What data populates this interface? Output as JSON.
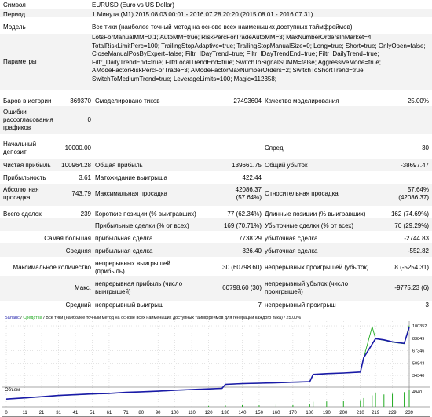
{
  "report": {
    "symbol_label": "Символ",
    "symbol_value": "EURUSD (Euro vs US Dollar)",
    "period_label": "Период",
    "period_value": "1 Минута (M1) 2015.08.03 00:01 - 2016.07.28 20:20 (2015.08.01 - 2016.07.31)",
    "model_label": "Модель",
    "model_value": "Все тики (наиболее точный метод на основе всех наименьших доступных таймфреймов)",
    "params_label": "Параметры",
    "params_value": "LotsForManualMM=0.1; AutoMM=true; RiskPercForTradeAutoMM=3; MaxNumberOrdersInMarket=4; TotalRiskLimitPerc=100; TrailingStopAdaptive=true; TrailingStopManualSize=0; Long=true; Short=true; OnlyOpen=false; CloseManualPosByExpert=false; Filtr_IDayTrend=true; Filtr_IDayTrendEnd=true; Filtr_DailyTrend=true; Filtr_DailyTrendEnd=true; FiltrLocalTrendEnd=true; SwitchToSignalSUMM=false; AggressiveMode=true; AModeFactorRiskPercForTrade=3; AModeFactorMaxNumberOrders=2; SwitchToShortTrend=true; SwitchToMediumTrend=true; LeverageLimits=100; Magic=112358;",
    "bars_label": "Баров в истории",
    "bars_value": "369370",
    "ticks_label": "Смоделировано тиков",
    "ticks_value": "27493604",
    "quality_label": "Качество моделирования",
    "quality_value": "25.00%",
    "errors_label": "Ошибки рассогласования графиков",
    "errors_value": "0",
    "deposit_label": "Начальный депозит",
    "deposit_value": "10000.00",
    "spread_label": "Спред",
    "spread_value": "30",
    "net_label": "Чистая прибыль",
    "net_value": "100964.28",
    "gross_profit_label": "Общая прибыль",
    "gross_profit_value": "139661.75",
    "gross_loss_label": "Общий убыток",
    "gross_loss_value": "-38697.47",
    "pf_label": "Прибыльность",
    "pf_value": "3.61",
    "expected_label": "Матожидание выигрыша",
    "expected_value": "422.44",
    "abs_dd_label": "Абсолютная просадка",
    "abs_dd_value": "743.79",
    "max_dd_label": "Максимальная просадка",
    "max_dd_value": "42086.37",
    "max_dd_pct": "(57.64%)",
    "rel_dd_label": "Относительная просадка",
    "rel_dd_value": "57.64%",
    "rel_dd_money": "(42086.37)",
    "total_trades_label": "Всего сделок",
    "total_trades_value": "239",
    "short_label": "Короткие позиции (% выигравших)",
    "short_value": "77 (62.34%)",
    "long_label": "Длинные позиции (% выигравших)",
    "long_value": "162 (74.69%)",
    "profit_trades_label": "Прибыльные сделки (% от всех)",
    "profit_trades_value": "169 (70.71%)",
    "loss_trades_label": "Убыточные сделки (% от всех)",
    "loss_trades_value": "70 (29.29%)",
    "largest_label": "Самая большая",
    "largest_profit_label": "прибыльная сделка",
    "largest_profit_value": "7738.29",
    "largest_loss_label": "убыточная сделка",
    "largest_loss_value": "-2744.83",
    "average_label": "Средняя",
    "avg_profit_label": "прибыльная сделка",
    "avg_profit_value": "826.40",
    "avg_loss_label": "убыточная сделка",
    "avg_loss_value": "-552.82",
    "maxcount_label": "Максимальное количество",
    "cons_wins_label": "непрерывных выигрышей (прибыль)",
    "cons_wins_value": "30 (60798.60)",
    "cons_losses_label": "непрерывных проигрышей (убыток)",
    "cons_losses_value": "8 (-5254.31)",
    "max_label": "Макс.",
    "cons_profit_label": "непрерывная прибыль (число выигрышей)",
    "cons_profit_value": "60798.60 (30)",
    "cons_loss_label": "непрерывный убыток (число проигрышей)",
    "cons_loss_value": "-9775.23 (6)",
    "avg_cons_label": "Средний",
    "avg_wins_label": "непрерывный выигрыш",
    "avg_wins_value": "7",
    "avg_losses_label": "непрерывный проигрыш",
    "avg_losses_value": "3"
  },
  "chart_header": {
    "balance": "Баланс",
    "sep1": " / ",
    "equity": "Средства",
    "sep2": " / ",
    "rest": "Все тики (наиболее точный метод на основе всех наименьших доступных таймфреймов для генерации каждого тика) / 25.00%"
  },
  "volume_label": "Объем",
  "colors": {
    "balance": "#1a1aa8",
    "equity": "#22aa22",
    "volume": "#22aa22",
    "grid": "#c8c8c8"
  },
  "chart_data": {
    "type": "line",
    "y_ticks": [
      "100352",
      "83849",
      "67346",
      "50843",
      "34340"
    ],
    "volume_ticks": [
      "4940"
    ],
    "x_ticks": [
      "0",
      "11",
      "21",
      "31",
      "41",
      "51",
      "61",
      "71",
      "80",
      "90",
      "100",
      "110",
      "120",
      "130",
      "140",
      "150",
      "160",
      "170",
      "180",
      "190",
      "200",
      "210",
      "219",
      "229",
      "239"
    ],
    "xlim": [
      0,
      239
    ],
    "ylim": [
      26000,
      108000
    ],
    "series": [
      {
        "name": "Баланс",
        "x": [
          0,
          11,
          21,
          31,
          41,
          51,
          61,
          71,
          80,
          90,
          100,
          110,
          120,
          128,
          130,
          140,
          150,
          160,
          170,
          180,
          182,
          190,
          200,
          210,
          212,
          219,
          224,
          229,
          236,
          239
        ],
        "values": [
          10000,
          11500,
          13000,
          14500,
          15500,
          16500,
          17200,
          18500,
          19200,
          20000,
          21200,
          22000,
          22800,
          23500,
          28500,
          29500,
          30000,
          30500,
          31200,
          31800,
          41000,
          42000,
          42800,
          44000,
          62000,
          86000,
          84500,
          82000,
          80000,
          100352
        ]
      },
      {
        "name": "Средства",
        "x": [
          0,
          11,
          21,
          31,
          41,
          51,
          61,
          71,
          80,
          90,
          100,
          110,
          120,
          128,
          130,
          140,
          150,
          160,
          170,
          180,
          182,
          190,
          200,
          210,
          212,
          217,
          219,
          224,
          229,
          236,
          239
        ],
        "values": [
          10000,
          11300,
          12800,
          14300,
          15300,
          16300,
          17000,
          18300,
          19000,
          19800,
          21000,
          21800,
          22600,
          23300,
          28300,
          29300,
          29800,
          30300,
          31000,
          31600,
          40800,
          41800,
          42600,
          43800,
          61800,
          101000,
          86000,
          84000,
          81500,
          79500,
          102500
        ]
      }
    ],
    "volume": {
      "name": "Объем",
      "x": [
        120,
        130,
        140,
        150,
        160,
        170,
        180,
        182,
        190,
        200,
        210,
        212,
        217,
        219,
        224,
        229,
        236,
        239
      ],
      "values": [
        300,
        400,
        500,
        450,
        600,
        500,
        700,
        1500,
        1600,
        1800,
        2000,
        2600,
        3400,
        4200,
        3700,
        3900,
        4400,
        4940
      ]
    }
  }
}
